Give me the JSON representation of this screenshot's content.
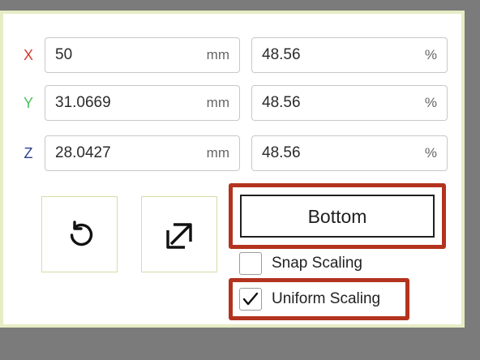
{
  "transform": {
    "rows": [
      {
        "axis": "X",
        "axis_color": "#d83a2e",
        "size_value": "50",
        "size_unit": "mm",
        "scale_value": "48.56",
        "scale_unit": "%"
      },
      {
        "axis": "Y",
        "axis_color": "#4cc25b",
        "size_value": "31.0669",
        "size_unit": "mm",
        "scale_value": "48.56",
        "scale_unit": "%"
      },
      {
        "axis": "Z",
        "axis_color": "#2c3f8f",
        "size_value": "28.0427",
        "size_unit": "mm",
        "scale_value": "48.56",
        "scale_unit": "%"
      }
    ]
  },
  "actions": {
    "reset_icon": "rotate-ccw-icon",
    "lay_flat_icon": "arrow-up-right-icon",
    "bottom_label": "Bottom"
  },
  "options": {
    "snap_scaling_label": "Snap Scaling",
    "snap_scaling_checked": false,
    "uniform_scaling_label": "Uniform Scaling",
    "uniform_scaling_checked": true
  },
  "colors": {
    "highlight": "#b3331e",
    "panel_border": "#e7ecc4",
    "background": "#7b7b7b"
  }
}
